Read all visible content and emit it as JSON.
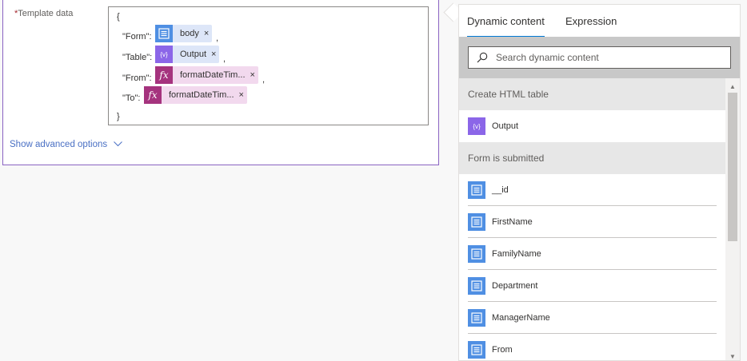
{
  "card": {
    "field_required_mark": "*",
    "field_label": "Template data",
    "code": {
      "open_brace": "{",
      "close_brace": "}",
      "rows": [
        {
          "key": "\"Form\":",
          "token_label": "body",
          "token_icon": "form-icon",
          "comma": ","
        },
        {
          "key": "\"Table\":",
          "token_label": "Output",
          "token_icon": "variable-icon",
          "comma": ","
        },
        {
          "key": "\"From\":",
          "token_label": "formatDateTim...",
          "token_icon": "fx-icon",
          "comma": ","
        },
        {
          "key": "\"To\":",
          "token_label": "formatDateTim...",
          "token_icon": "fx-icon",
          "comma": ""
        }
      ],
      "close_glyph": "×",
      "fx_glyph": "fx",
      "var_glyph": "{v}"
    },
    "show_advanced": "Show advanced options"
  },
  "panel": {
    "tabs": [
      "Dynamic content",
      "Expression"
    ],
    "active_tab": "Dynamic content",
    "search": {
      "placeholder": "Search dynamic content",
      "value": ""
    },
    "sections": [
      {
        "title": "Create HTML table",
        "items": [
          {
            "label": "Output",
            "icon": "variable-icon"
          }
        ]
      },
      {
        "title": "Form is submitted",
        "items": [
          {
            "label": "__id",
            "icon": "form-icon"
          },
          {
            "label": "FirstName",
            "icon": "form-icon"
          },
          {
            "label": "FamilyName",
            "icon": "form-icon"
          },
          {
            "label": "Department",
            "icon": "form-icon"
          },
          {
            "label": "ManagerName",
            "icon": "form-icon"
          },
          {
            "label": "From",
            "icon": "form-icon"
          }
        ]
      }
    ]
  },
  "colors": {
    "card_border": "#8a63c2",
    "form_token_icon": "#4f8fe3",
    "variable_token_icon": "#8b66e8",
    "fx_token_icon": "#a5337e",
    "accent": "#0078d4",
    "link": "#4a70c4"
  }
}
